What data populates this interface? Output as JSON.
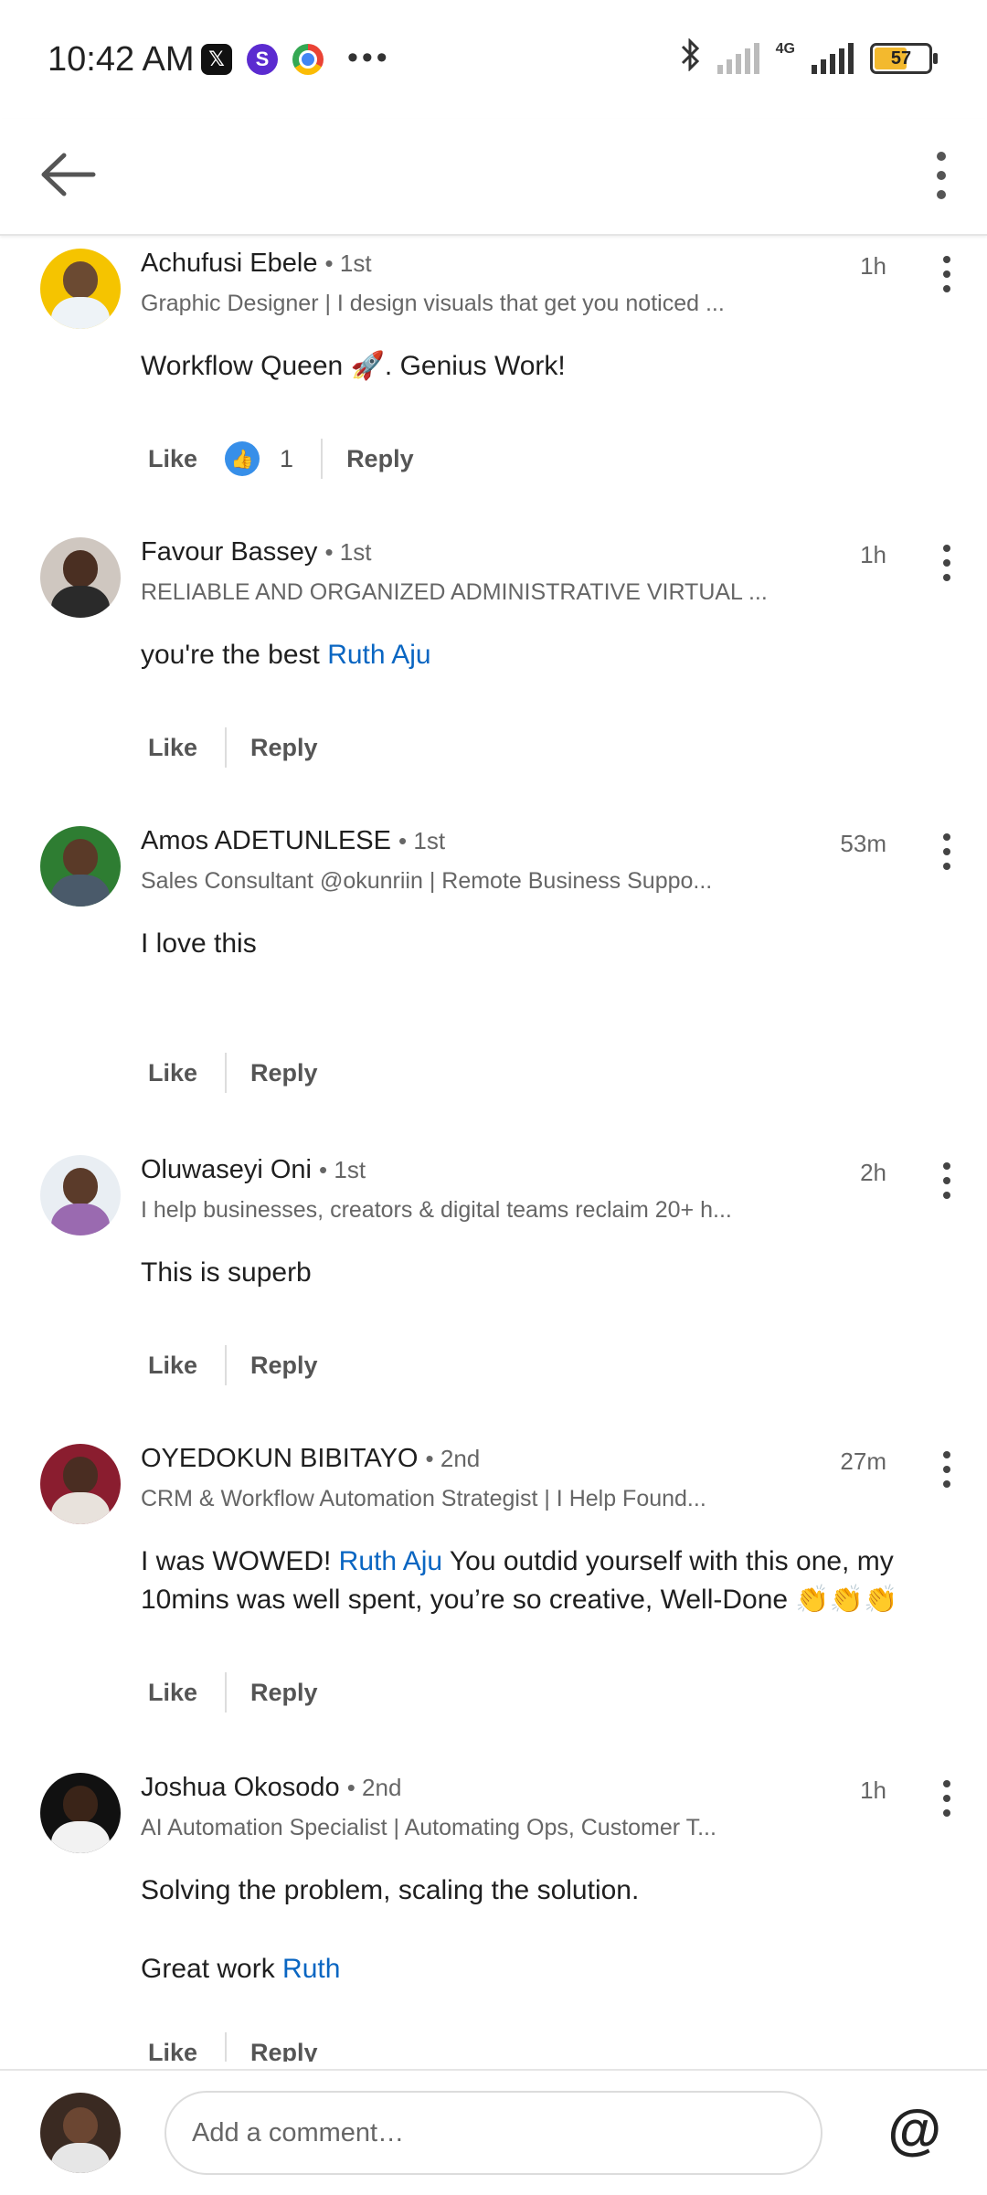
{
  "status_bar": {
    "time": "10:42 AM",
    "network": "4G",
    "battery": "57",
    "icons": [
      "x-app-icon",
      "s-app-icon",
      "chrome-icon",
      "more-dots-icon",
      "bluetooth-icon",
      "signal-icon",
      "battery-icon"
    ]
  },
  "app_bar": {
    "icons": [
      "back-arrow-icon",
      "overflow-menu-icon"
    ]
  },
  "comments": [
    {
      "name": "Achufusi Ebele",
      "degree": "• 1st",
      "headline": "Graphic Designer | I design visuals that get you noticed ...",
      "time": "1h",
      "body": [
        {
          "text": "Workflow Queen 🚀. Genius Work!"
        }
      ],
      "like_label": "Like",
      "reaction_count": "1",
      "reply_label": "Reply"
    },
    {
      "name": "Favour Bassey",
      "degree": "• 1st",
      "headline": "RELIABLE AND ORGANIZED ADMINISTRATIVE VIRTUAL ...",
      "time": "1h",
      "body": [
        {
          "text": "you're the best "
        },
        {
          "mention": "Ruth Aju"
        }
      ],
      "like_label": "Like",
      "reply_label": "Reply"
    },
    {
      "name": "Amos ADETUNLESE",
      "degree": "• 1st",
      "headline": "Sales Consultant @okunriin | Remote Business Suppo...",
      "time": "53m",
      "body": [
        {
          "text": "I love this"
        }
      ],
      "like_label": "Like",
      "reply_label": "Reply"
    },
    {
      "name": "Oluwaseyi Oni",
      "degree": "• 1st",
      "headline": "I help businesses, creators & digital teams reclaim 20+ h...",
      "time": "2h",
      "body": [
        {
          "text": "This is superb"
        }
      ],
      "like_label": "Like",
      "reply_label": "Reply"
    },
    {
      "name": "OYEDOKUN BIBITAYO",
      "degree": "• 2nd",
      "headline": "CRM & Workflow Automation Strategist | I Help Found...",
      "time": "27m",
      "body": [
        {
          "text": "I was WOWED! "
        },
        {
          "mention": "Ruth Aju"
        },
        {
          "text": " You outdid yourself with this one, my 10mins was well spent, you’re so creative, Well-Done 👏👏👏"
        }
      ],
      "like_label": "Like",
      "reply_label": "Reply"
    },
    {
      "name": "Joshua Okosodo",
      "degree": "• 2nd",
      "headline": "AI Automation Specialist | Automating Ops, Customer T...",
      "time": "1h",
      "body": [
        {
          "text": "Solving the problem, scaling the solution."
        }
      ],
      "body2": [
        {
          "text": "Great work "
        },
        {
          "mention": "Ruth"
        }
      ],
      "like_label": "Like",
      "reply_label": "Reply"
    }
  ],
  "comment_box": {
    "placeholder": "Add a comment…",
    "icons": [
      "profile-avatar",
      "mention-at-icon"
    ]
  },
  "colors": {
    "mention": "#0a66c2",
    "reaction": "#378fe9",
    "battery_fill": "#f3b92e"
  }
}
